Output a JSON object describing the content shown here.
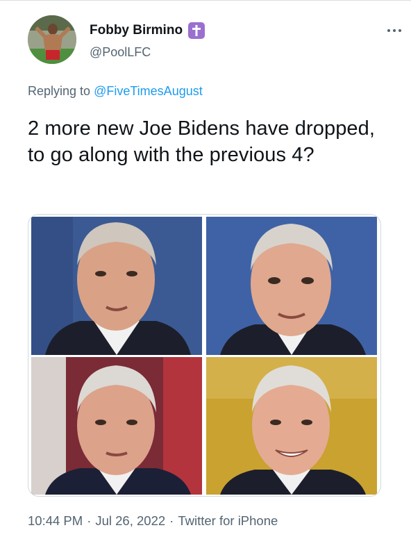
{
  "author": {
    "display_name": "Fobby Birmino",
    "handle": "@PoolLFC",
    "badge_icon": "cross-icon",
    "badge_color": "#9b6fd0"
  },
  "reply": {
    "prefix": "Replying to",
    "mention": "@FiveTimesAugust"
  },
  "tweet": {
    "text": "2 more new Joe Bidens have dropped, to go along with the previous 4?"
  },
  "media": {
    "images": [
      {
        "background": "#3b5a93"
      },
      {
        "background": "#3f62a6"
      },
      {
        "background": "#7a2b35"
      },
      {
        "background": "#c9a230"
      }
    ]
  },
  "meta": {
    "time": "10:44 PM",
    "date": "Jul 26, 2022",
    "source": "Twitter for iPhone",
    "separator": "·"
  },
  "colors": {
    "link": "#1d9bf0",
    "secondary_text": "#536471",
    "primary_text": "#0f1419"
  }
}
